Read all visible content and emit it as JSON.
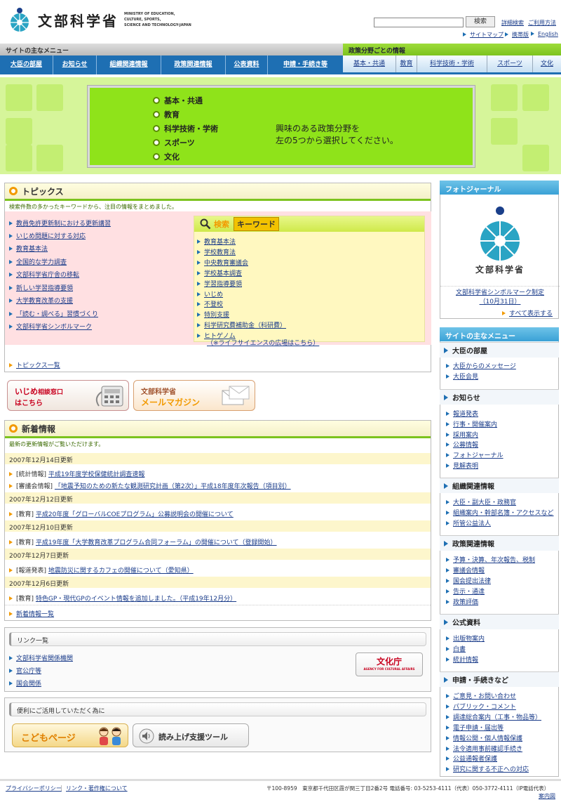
{
  "header": {
    "logo_title": "文部科学省",
    "logo_sub": [
      "MINISTRY OF EDUCATION,",
      "CULTURE, SPORTS,",
      "SCIENCE AND TECHNOLOGY-JAPAN"
    ],
    "search_button": "検索",
    "links": [
      "詳細検索",
      "ご利用方法",
      "サイトマップ",
      "携帯版",
      "English"
    ]
  },
  "nav": {
    "left_label": "サイトの主なメニュー",
    "right_label": "政策分野ごとの情報",
    "left_items": [
      "大臣の部屋",
      "お知らせ",
      "組織関連情報",
      "政策関連情報",
      "公表資料",
      "申請・手続き等"
    ],
    "right_items": [
      "基本・共通",
      "教育",
      "科学技術・学術",
      "スポーツ",
      "文化"
    ]
  },
  "banner": {
    "categories": [
      "基本・共通",
      "教育",
      "科学技術・学術",
      "スポーツ",
      "文化"
    ],
    "message_line1": "興味のある政策分野を",
    "message_line2": "左の5つから選択してください。"
  },
  "topics": {
    "title": "トピックス",
    "desc": "検索件数の多かったキーワードから、注目の情報をまとめました。",
    "items": [
      "教員免許更新制における更新講習",
      "いじめ問題に対する対応",
      "教育基本法",
      "全国的な学力調査",
      "文部科学省庁舎の移転",
      "新しい学習指導要領",
      "大学教育改革の支援",
      "「読む・調べる」習慣づくり",
      "文部科学省シンボルマーク"
    ],
    "keyword_label": "検索",
    "keyword_badge": "キーワード",
    "keywords": [
      "教育基本法",
      "学校教育法",
      "中央教育審議会",
      "学校基本調査",
      "学習指導要領",
      "いじめ",
      "不登校",
      "特別支援",
      "科学研究費補助金（科研費）",
      "ヒトゲノム"
    ],
    "keyword_note": "（※ライフサイエンスの広場はこちら）",
    "more": "トピックス一覧"
  },
  "promo": {
    "ijime_line1": "いじめ",
    "ijime_line1b": "相談窓口",
    "ijime_line2": "はこちら",
    "mail_line1": "文部科学省",
    "mail_line2": "メールマガジン"
  },
  "news": {
    "title": "新着情報",
    "desc": "最新の更新情報がご覧いただけます。",
    "groups": [
      {
        "date": "2007年12月14日更新",
        "items": [
          {
            "cat": "[統計情報]",
            "text": "平成19年度学校保健統計調査速報"
          },
          {
            "cat": "[審議会情報]",
            "text": "「地震予知のための新たな観測研究計画（第2次）」平成18年度年次報告（項目別）"
          }
        ]
      },
      {
        "date": "2007年12月12日更新",
        "items": [
          {
            "cat": "[教育]",
            "text": "平成20年度「グローバルCOEプログラム」公募説明会の開催について"
          }
        ]
      },
      {
        "date": "2007年12月10日更新",
        "items": [
          {
            "cat": "[教育]",
            "text": "平成19年度「大学教育改革プログラム合同フォーラム」の開催について（登録開始）"
          }
        ]
      },
      {
        "date": "2007年12月7日更新",
        "items": [
          {
            "cat": "[報道発表]",
            "text": "地震防災に関するカフェの開催について（愛知県）"
          }
        ]
      },
      {
        "date": "2007年12月6日更新",
        "items": [
          {
            "cat": "[教育]",
            "text": "特色GP・現代GPのイベント情報を追加しました。（平成19年12月分）"
          }
        ]
      }
    ],
    "more": "新着情報一覧"
  },
  "links": {
    "title": "リンク一覧",
    "items": [
      "文部科学省関係機関",
      "官公庁等",
      "国会関係"
    ],
    "bunka_name": "文化庁",
    "bunka_en": "AGENCY FOR CULTURAL AFFAIRS"
  },
  "convenience": {
    "title": "便利にご活用していただく為に",
    "kodomo": "こどもページ",
    "yomiage": "読み上げ支援ツール"
  },
  "sidebar": {
    "photo_title": "フォトジャーナル",
    "photo_logo": "文部科学省",
    "photo_caption1": "文部科学省シンボルマーク制定",
    "photo_caption2": "（10月31日）",
    "photo_more": "すべて表示する",
    "menu_title": "サイトの主なメニュー",
    "sections": [
      {
        "title": "大臣の部屋",
        "items": [
          "大臣からのメッセージ",
          "大臣会見"
        ]
      },
      {
        "title": "お知らせ",
        "items": [
          "報道発表",
          "行事・開催案内",
          "採用案内",
          "公募情報",
          "フォトジャーナル",
          "見解表明"
        ]
      },
      {
        "title": "組織関連情報",
        "items": [
          "大臣・副大臣・政務官",
          "組織案内・幹部名簿・アクセスなど",
          "所管公益法人"
        ]
      },
      {
        "title": "政策関連情報",
        "items": [
          "予算・決算、年次報告、税制",
          "審議会情報",
          "国会提出法律",
          "告示・通達",
          "政策評価"
        ]
      },
      {
        "title": "公式資料",
        "items": [
          "出版物案内",
          "白書",
          "統計情報"
        ]
      },
      {
        "title": "申請・手続きなど",
        "items": [
          "ご意見・お問い合わせ",
          "パブリック・コメント",
          "調達総合案内（工事・物品等）",
          "電子申請・届出等",
          "情報公開・個人情報保護",
          "法令適用事前確認手続き",
          "公益通報者保護",
          "研究に関する不正への対応"
        ]
      }
    ]
  },
  "footer": {
    "privacy": "プライバシーポリシー",
    "separator": "|",
    "links": "リンク・著作権について",
    "address": "〒100-8959　東京都千代田区霞が関三丁目2番2号 電話番号: 03-5253-4111（代表）050-3772-4111（IP電話代表）",
    "guide": "案内図"
  },
  "colors": {
    "nav_blue": "#1e6fb3",
    "green": "#7cc31e",
    "banner_green": "#8fe31a",
    "orange": "#f29a00"
  }
}
